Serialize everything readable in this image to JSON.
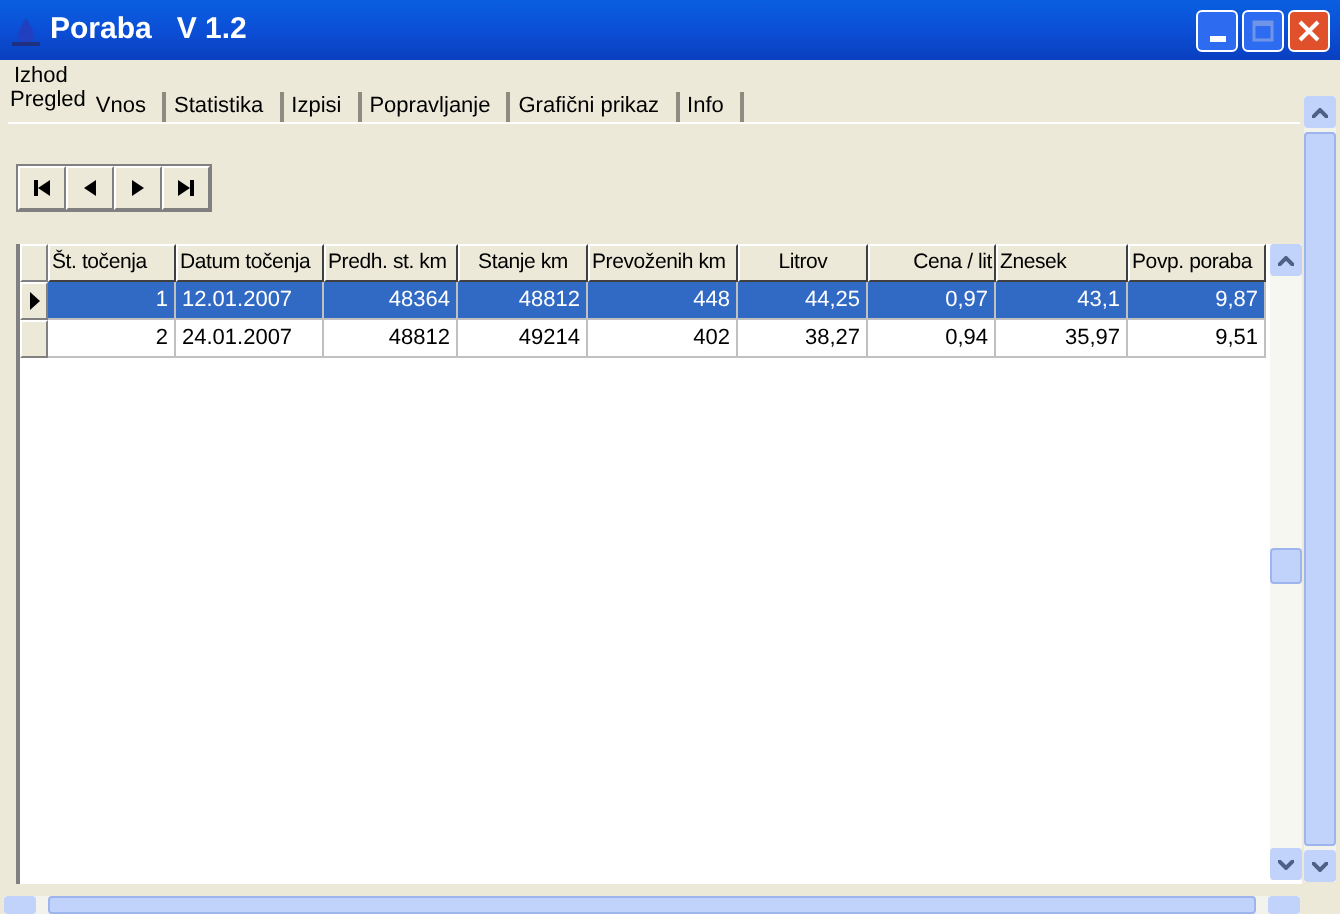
{
  "window": {
    "title": "Poraba   V 1.2"
  },
  "menu": [
    "Izhod"
  ],
  "tabs": [
    {
      "label": "Pregled",
      "selected": true
    },
    {
      "label": "Vnos",
      "selected": false
    },
    {
      "label": "Statistika",
      "selected": false
    },
    {
      "label": "Izpisi",
      "selected": false
    },
    {
      "label": "Popravljanje",
      "selected": false
    },
    {
      "label": "Grafični prikaz",
      "selected": false
    },
    {
      "label": "Info",
      "selected": false
    }
  ],
  "navigator": [
    {
      "kind": "first"
    },
    {
      "kind": "prior"
    },
    {
      "kind": "next"
    },
    {
      "kind": "last"
    }
  ],
  "table": {
    "columns": [
      "Št. točenja",
      "Datum točenja",
      "Predh. st. km",
      "Stanje km",
      "Prevoženih km",
      "Litrov",
      "Cena / lit",
      "Znesek",
      "Povp. poraba"
    ],
    "rows": [
      {
        "selected": true,
        "cells": [
          "1",
          "12.01.2007",
          "48364",
          "48812",
          "448",
          "44,25",
          "0,97",
          "43,1",
          "9,87"
        ]
      },
      {
        "selected": false,
        "cells": [
          "2",
          "24.01.2007",
          "48812",
          "49214",
          "402",
          "38,27",
          "0,94",
          "35,97",
          "9,51"
        ]
      }
    ]
  }
}
